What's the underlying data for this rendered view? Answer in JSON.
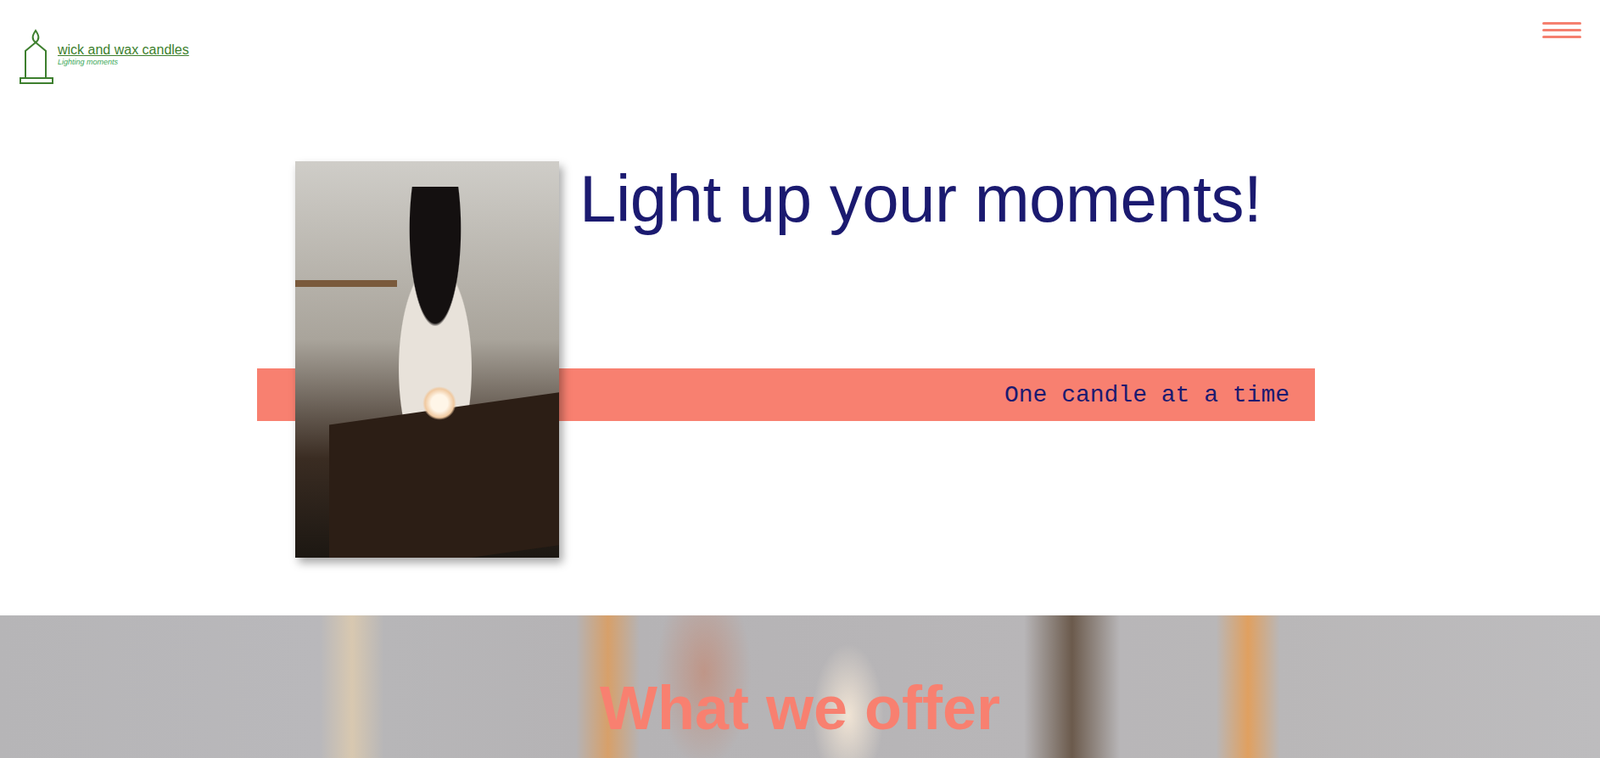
{
  "logo": {
    "name": "wick and wax candles",
    "tagline": "Lighting moments"
  },
  "hero": {
    "title": "Light up your moments!",
    "tagline": "One candle at a time"
  },
  "offer": {
    "title": "What we offer"
  }
}
